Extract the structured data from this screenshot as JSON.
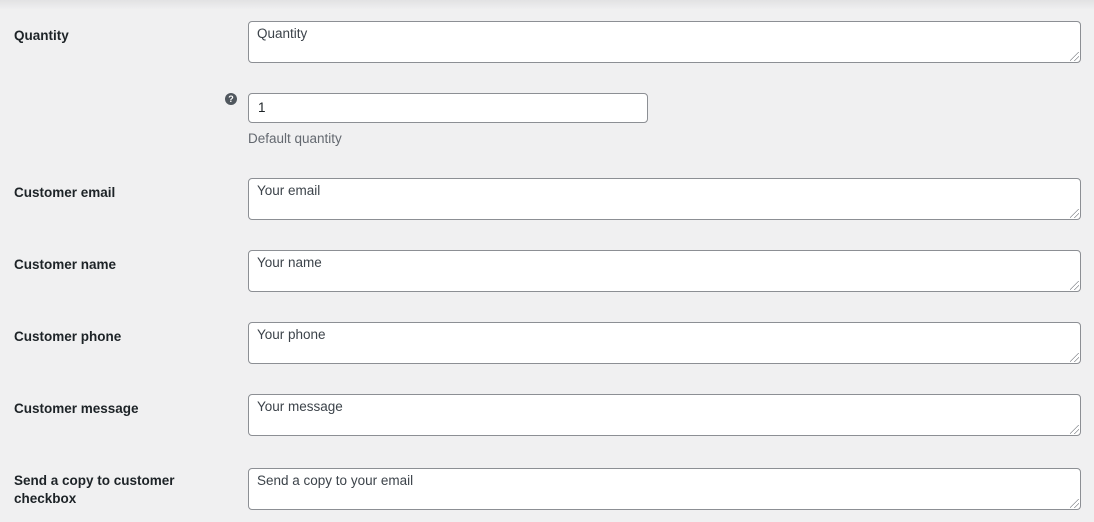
{
  "fields": {
    "quantity": {
      "label": "Quantity",
      "value": "Quantity"
    },
    "default_quantity": {
      "value": "1",
      "description": "Default quantity",
      "help_icon": "question-mark-circle"
    },
    "email": {
      "label": "Customer email",
      "value": "Your email"
    },
    "name": {
      "label": "Customer name",
      "value": "Your name"
    },
    "phone": {
      "label": "Customer phone",
      "value": "Your phone"
    },
    "message": {
      "label": "Customer message",
      "value": "Your message"
    },
    "copy_checkbox": {
      "label": "Send a copy to customer checkbox",
      "value": "Send a copy to your email"
    }
  },
  "colors": {
    "background": "#f0f0f1",
    "field_border": "#8c8f94",
    "field_background": "#ffffff",
    "label_text": "#1d2327",
    "description_text": "#646970"
  }
}
